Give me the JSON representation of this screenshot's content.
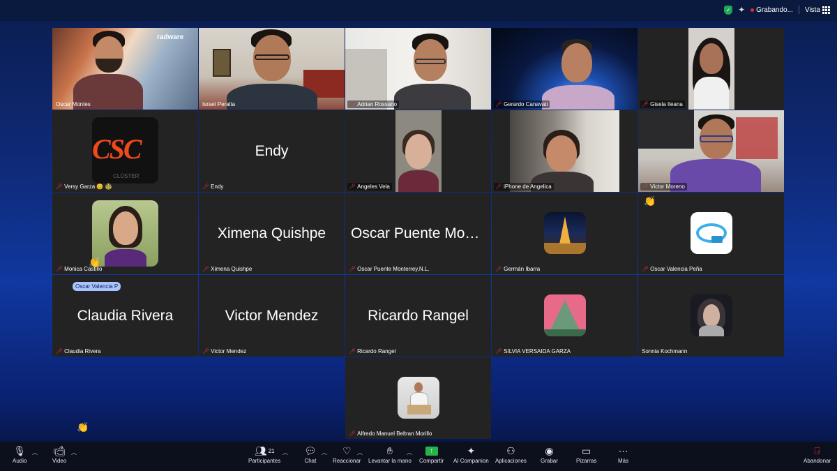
{
  "topbar": {
    "recording_label": "Grabando...",
    "view_label": "Vista"
  },
  "tiles": [
    {
      "name": "Oscar Montes",
      "type": "video",
      "muted": false,
      "brand_text": "radware"
    },
    {
      "name": "Israel Peralta",
      "type": "video",
      "muted": false,
      "active": true
    },
    {
      "name": "Adrian Rossano",
      "type": "video",
      "muted": true
    },
    {
      "name": "Gerardo Canavati",
      "type": "video",
      "muted": true
    },
    {
      "name": "Gisela Ileana",
      "type": "video",
      "muted": true
    },
    {
      "name": "Versy Garza 😊 🥸",
      "type": "avatar",
      "muted": true,
      "logo_text": "CSC",
      "logo_sub": "CLÚSTER"
    },
    {
      "name": "Endy",
      "type": "text",
      "muted": true,
      "display": "Endy"
    },
    {
      "name": "Angeles Vela",
      "type": "video",
      "muted": true
    },
    {
      "name": "iPhone de Angelica",
      "type": "video",
      "muted": true
    },
    {
      "name": "Victor Moreno",
      "type": "video",
      "muted": true
    },
    {
      "name": "Monica Castillo",
      "type": "avatar",
      "muted": true
    },
    {
      "name": "Ximena Quishpe",
      "type": "text",
      "muted": true,
      "display": "Ximena Quishpe"
    },
    {
      "name": "Oscar Puente Monterrey,N.L.",
      "type": "text",
      "muted": true,
      "display": "Oscar Puente Mont..."
    },
    {
      "name": "Germán Ibarra",
      "type": "avatar",
      "muted": true
    },
    {
      "name": "Oscar Valencia Peña",
      "type": "avatar",
      "muted": true
    },
    {
      "name": "Claudia Rivera",
      "type": "text",
      "muted": true,
      "display": "Claudia Rivera"
    },
    {
      "name": "Victor Mendez",
      "type": "text",
      "muted": true,
      "display": "Victor Mendez"
    },
    {
      "name": "Ricardo Rangel",
      "type": "text",
      "muted": true,
      "display": "Ricardo Rangel"
    },
    {
      "name": "SILVIA VERSAIDA GARZA",
      "type": "avatar",
      "muted": true
    },
    {
      "name": "Sonnia Kochmann",
      "type": "avatar",
      "muted": false
    },
    {
      "name": "Alfredo Manuel Beltran Morillo",
      "type": "avatar",
      "muted": true
    }
  ],
  "overlay": {
    "hover_chip": "Oscar Valencia P"
  },
  "toolbar": {
    "audio": "Audio",
    "video": "Video",
    "participants": "Participantes",
    "participants_count": "21",
    "chat": "Chat",
    "react": "Reaccionar",
    "raise_hand": "Levantar la mano",
    "share": "Compartir",
    "ai_companion": "AI Companion",
    "apps": "Aplicaciones",
    "record": "Grabar",
    "whiteboards": "Pizarras",
    "more": "Más",
    "leave": "Abandonar"
  },
  "colors": {
    "active_speaker": "#3fb34a",
    "muted_icon": "#e03434",
    "share_green": "#27b34a",
    "tile_bg": "#232323"
  }
}
